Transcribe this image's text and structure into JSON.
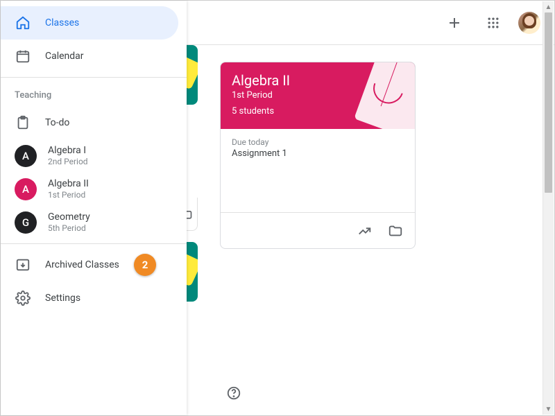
{
  "sidebar": {
    "top": [
      {
        "label": "Classes",
        "icon": "home",
        "active": true
      },
      {
        "label": "Calendar",
        "icon": "calendar",
        "active": false
      }
    ],
    "section_label": "Teaching",
    "todo_label": "To-do",
    "classes": [
      {
        "name": "Algebra I",
        "sub": "2nd Period",
        "avatar_bg": "#202124",
        "avatar_letter": "A"
      },
      {
        "name": "Algebra II",
        "sub": "1st Period",
        "avatar_bg": "#d81b60",
        "avatar_letter": "A"
      },
      {
        "name": "Geometry",
        "sub": "5th Period",
        "avatar_bg": "#202124",
        "avatar_letter": "G"
      }
    ],
    "archived_label": "Archived Classes",
    "settings_label": "Settings",
    "badge": "2"
  },
  "card": {
    "title": "Algebra II",
    "subtitle": "1st Period",
    "students": "5 students",
    "due_label": "Due today",
    "assignment": "Assignment 1"
  }
}
